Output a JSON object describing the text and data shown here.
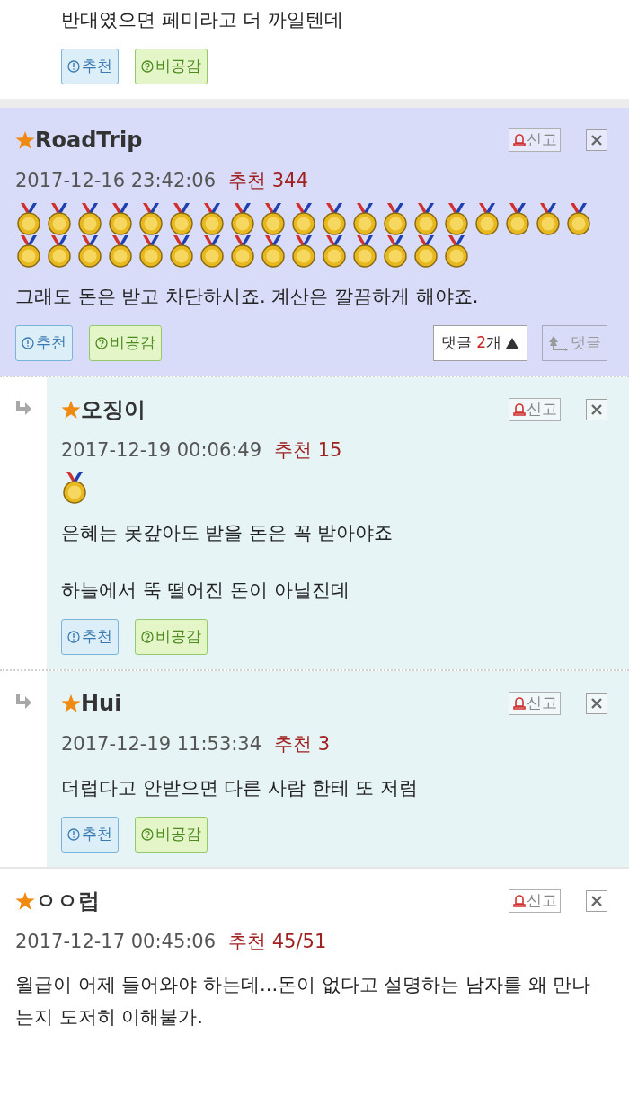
{
  "comments": [
    {
      "kind": "plain_indented",
      "paragraphs": [
        "반대였으면 페미라고 더 까일텐데"
      ],
      "buttons": [
        {
          "kind": "recommend",
          "label": "추천"
        },
        {
          "kind": "unlike",
          "label": "비공감"
        }
      ]
    },
    {
      "kind": "best",
      "author": "RoadTrip",
      "date": "2017-12-16 23:42:06",
      "score_label": "추천",
      "score": "344",
      "report": "신고",
      "medals": [
        {
          "kind": "medal"
        },
        {
          "kind": "medal"
        },
        {
          "kind": "medal"
        },
        {
          "kind": "medal"
        },
        {
          "kind": "medal"
        },
        {
          "kind": "medal"
        },
        {
          "kind": "medal"
        },
        {
          "kind": "medal"
        },
        {
          "kind": "medal"
        },
        {
          "kind": "medal"
        },
        {
          "kind": "medal"
        },
        {
          "kind": "medal"
        },
        {
          "kind": "medal"
        },
        {
          "kind": "medal"
        },
        {
          "kind": "medal"
        },
        {
          "kind": "medal"
        },
        {
          "kind": "medal"
        },
        {
          "kind": "medal"
        },
        {
          "kind": "medal"
        },
        {
          "kind": "medal"
        },
        {
          "kind": "medal"
        },
        {
          "kind": "medal"
        },
        {
          "kind": "medal"
        },
        {
          "kind": "medal"
        },
        {
          "kind": "medal"
        },
        {
          "kind": "medal"
        },
        {
          "kind": "medal"
        },
        {
          "kind": "medal"
        },
        {
          "kind": "medal"
        },
        {
          "kind": "medal"
        },
        {
          "kind": "medal"
        },
        {
          "kind": "medal"
        },
        {
          "kind": "medal"
        },
        {
          "kind": "medal"
        }
      ],
      "paragraphs": [
        "그래도 돈은 받고 차단하시죠. 계산은 깔끔하게 해야죠."
      ],
      "buttons": [
        {
          "kind": "recommend",
          "label": "추천"
        },
        {
          "kind": "unlike",
          "label": "비공감"
        }
      ],
      "replies_toggle": {
        "label": "댓글",
        "count": "2",
        "unit": "개",
        "expanded": true
      },
      "reply_button": "댓글"
    },
    {
      "kind": "reply",
      "author": "오징이",
      "date": "2017-12-19 00:06:49",
      "score_label": "추천",
      "score": "15",
      "report": "신고",
      "medals": [
        {
          "kind": "medal"
        }
      ],
      "paragraphs": [
        "은혜는 못갚아도 받을 돈은 꼭 받아야죠",
        "하늘에서 뚝 떨어진 돈이 아닐진데"
      ],
      "buttons": [
        {
          "kind": "recommend",
          "label": "추천"
        },
        {
          "kind": "unlike",
          "label": "비공감"
        }
      ]
    },
    {
      "kind": "reply",
      "author": "Hui",
      "date": "2017-12-19 11:53:34",
      "score_label": "추천",
      "score": "3",
      "report": "신고",
      "paragraphs": [
        "더럽다고 안받으면 다른 사람 한테 또 저럼"
      ],
      "buttons": [
        {
          "kind": "recommend",
          "label": "추천"
        },
        {
          "kind": "unlike",
          "label": "비공감"
        }
      ]
    },
    {
      "kind": "plain",
      "author": "ㅇㅇ럽",
      "date": "2017-12-17 00:45:06",
      "score_label": "추천",
      "score": "45/51",
      "report": "신고",
      "paragraphs": [
        "월급이 어제 들어와야 하는데...돈이 없다고 설명하는 남자를 왜 만나는지 도저히 이해불가."
      ]
    }
  ]
}
